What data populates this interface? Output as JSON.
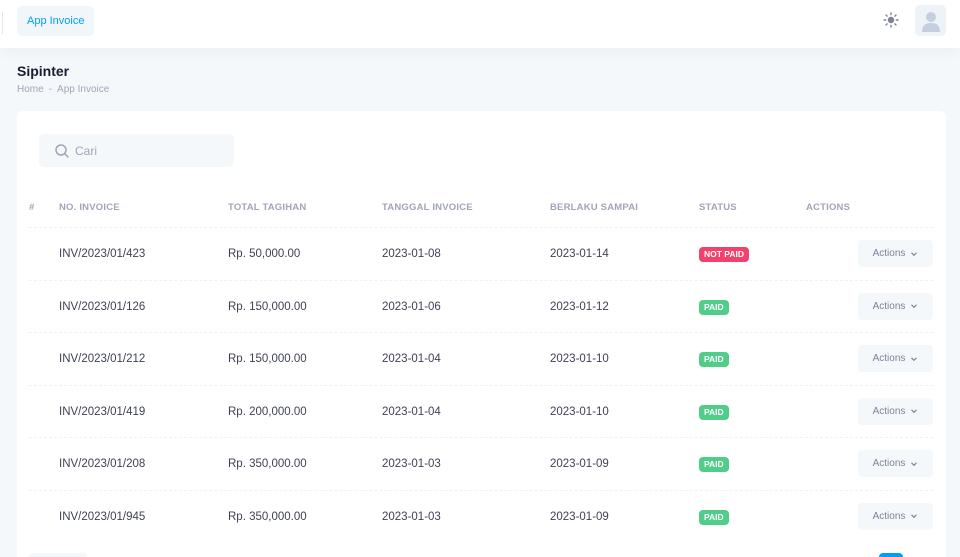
{
  "header": {
    "app_tab": "App Invoice",
    "theme_icon": "sun-icon",
    "avatar_icon": "user-icon"
  },
  "page": {
    "title": "Sipinter",
    "breadcrumb": [
      "Home",
      "App Invoice"
    ],
    "breadcrumb_sep": "-"
  },
  "search": {
    "placeholder": "Cari",
    "value": ""
  },
  "table": {
    "columns": [
      "#",
      "NO. INVOICE",
      "TOTAL TAGIHAN",
      "TANGGAL INVOICE",
      "BERLAKU SAMPAI",
      "STATUS",
      "ACTIONS"
    ],
    "rows": [
      {
        "no": "INV/2023/01/423",
        "total": "Rp. 50,000.00",
        "date": "2023-01-08",
        "due": "2023-01-14",
        "status": "NOT PAID",
        "action": "Actions"
      },
      {
        "no": "INV/2023/01/126",
        "total": "Rp. 150,000.00",
        "date": "2023-01-06",
        "due": "2023-01-12",
        "status": "PAID",
        "action": "Actions"
      },
      {
        "no": "INV/2023/01/212",
        "total": "Rp. 150,000.00",
        "date": "2023-01-04",
        "due": "2023-01-10",
        "status": "PAID",
        "action": "Actions"
      },
      {
        "no": "INV/2023/01/419",
        "total": "Rp. 200,000.00",
        "date": "2023-01-04",
        "due": "2023-01-10",
        "status": "PAID",
        "action": "Actions"
      },
      {
        "no": "INV/2023/01/208",
        "total": "Rp. 350,000.00",
        "date": "2023-01-03",
        "due": "2023-01-09",
        "status": "PAID",
        "action": "Actions"
      },
      {
        "no": "INV/2023/01/945",
        "total": "Rp. 350,000.00",
        "date": "2023-01-03",
        "due": "2023-01-09",
        "status": "PAID",
        "action": "Actions"
      }
    ]
  },
  "colors": {
    "primary": "#009ef7",
    "danger": "#f1416c",
    "success": "#50cd89"
  }
}
